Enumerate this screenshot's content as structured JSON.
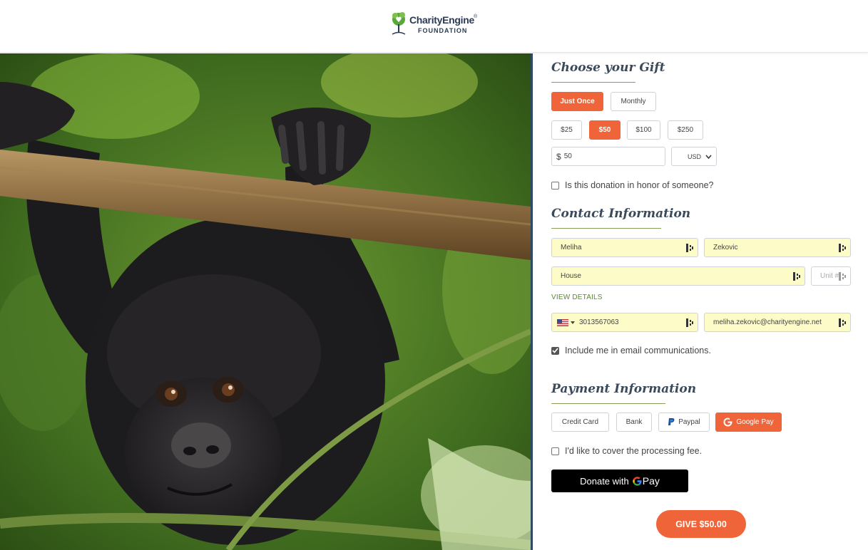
{
  "brand": {
    "name": "CharityEngine",
    "trademark": "®",
    "subtitle": "FOUNDATION"
  },
  "gift": {
    "title": "Choose your Gift",
    "frequency": [
      {
        "label": "Just Once",
        "active": true
      },
      {
        "label": "Monthly",
        "active": false
      }
    ],
    "amounts": [
      {
        "label": "$25",
        "active": false
      },
      {
        "label": "$50",
        "active": true
      },
      {
        "label": "$100",
        "active": false
      },
      {
        "label": "$250",
        "active": false
      }
    ],
    "currency_symbol": "$",
    "amount_value": "50",
    "currency": "USD",
    "honor_label": "Is this donation in honor of someone?",
    "honor_checked": false
  },
  "contact": {
    "title": "Contact Information",
    "first_name": "Meliha",
    "last_name": "Zekovic",
    "address": "House",
    "unit_placeholder": "Unit #",
    "view_details": "VIEW DETAILS",
    "phone": "3013567063",
    "email": "meliha.zekovic@charityengine.net",
    "email_opt_in_label": "Include me in email communications.",
    "email_opt_in_checked": true
  },
  "payment": {
    "title": "Payment Information",
    "methods": [
      {
        "label": "Credit Card",
        "active": false
      },
      {
        "label": "Bank",
        "active": false
      },
      {
        "label": "Paypal",
        "active": false,
        "icon": "paypal-icon"
      },
      {
        "label": "Google Pay",
        "active": true,
        "icon": "google-icon"
      }
    ],
    "fee_label": "I'd like to cover the processing fee.",
    "fee_checked": false,
    "donate_with": "Donate with",
    "pay_label": "Pay"
  },
  "submit_label": "GIVE $50.00",
  "colors": {
    "accent": "#f0643a",
    "autofill": "#fdfcc9",
    "heading": "#3b4a5a",
    "link": "#5a8a2a"
  }
}
